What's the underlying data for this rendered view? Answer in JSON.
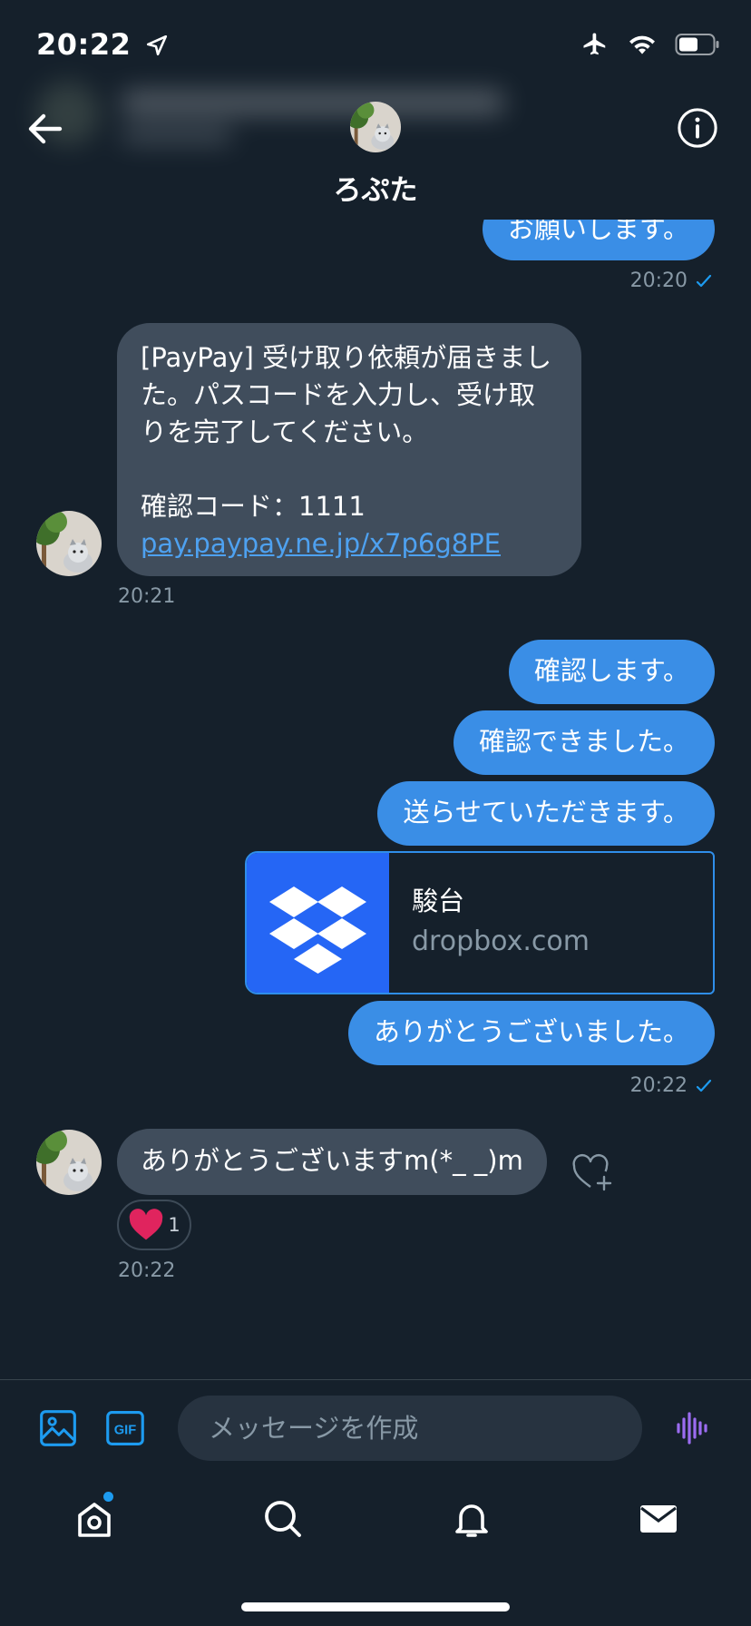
{
  "status_bar": {
    "time": "20:22"
  },
  "header": {
    "contact_name": "ろぷた"
  },
  "messages": {
    "partial_out": "お願いします。",
    "time_1": "20:20",
    "paypay_line1": "[PayPay] 受け取り依頼が届きまし",
    "paypay_line2": "た。パスコードを入力し、受け取",
    "paypay_line3": "りを完了してください。",
    "paypay_code": "確認コード：1111",
    "paypay_link": "pay.paypay.ne.jp/x7p6g8PE",
    "time_2": "20:21",
    "out_1": "確認します。",
    "out_2": "確認できました。",
    "out_3": "送らせていただきます。",
    "card_title": "駿台",
    "card_domain": "dropbox.com",
    "out_4": "ありがとうございました。",
    "time_3": "20:22",
    "in_thanks": "ありがとうございますm(*_ _)m",
    "reaction_count": "1",
    "time_4": "20:22"
  },
  "composer": {
    "placeholder": "メッセージを作成"
  },
  "icons": [
    "navigation-arrow-icon",
    "airplane-icon",
    "wifi-icon",
    "battery-icon",
    "back-arrow-icon",
    "info-icon",
    "checkmark-icon",
    "dropbox-icon",
    "heart-icon",
    "add-reaction-icon",
    "image-icon",
    "gif-icon",
    "voice-icon",
    "home-icon",
    "search-icon",
    "bell-icon",
    "mail-icon"
  ],
  "colors": {
    "background": "#15202b",
    "outgoing_bubble": "#3a8ee6",
    "incoming_bubble": "#404d5c",
    "accent": "#1d9bf0",
    "dropbox": "#2566f5",
    "heart": "#e0245e",
    "voice": "#9b6cf0"
  }
}
